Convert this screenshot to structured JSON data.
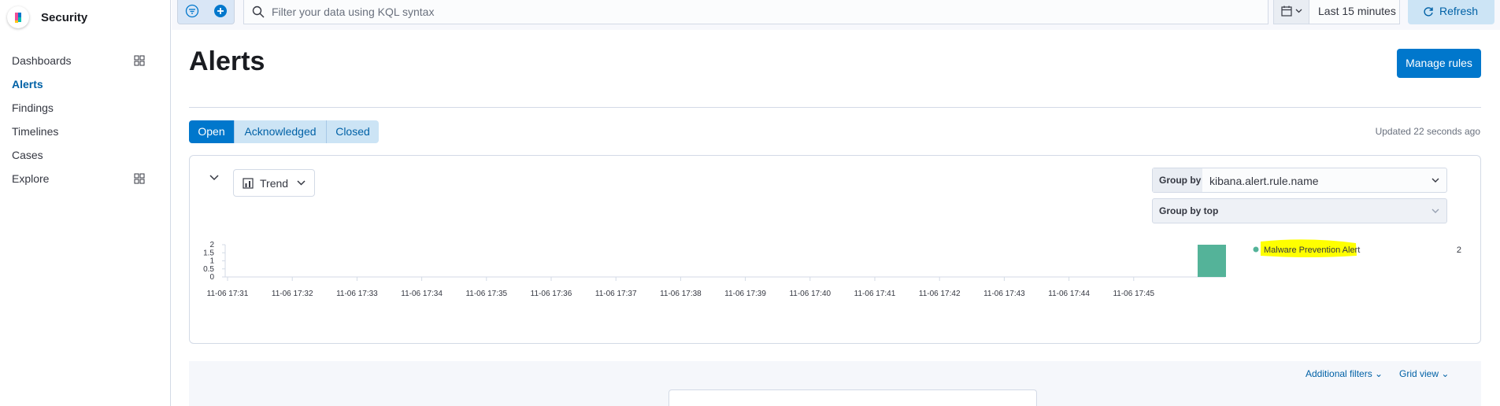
{
  "app": {
    "title": "Security"
  },
  "sidebar": {
    "items": [
      {
        "label": "Dashboards",
        "icon": "grid-icon"
      },
      {
        "label": "Alerts",
        "active": true
      },
      {
        "label": "Findings"
      },
      {
        "label": "Timelines"
      },
      {
        "label": "Cases"
      },
      {
        "label": "Explore",
        "icon": "grid-icon"
      }
    ]
  },
  "topbar": {
    "search_placeholder": "Filter your data using KQL syntax",
    "date_range": "Last 15 minutes",
    "refresh_label": "Refresh"
  },
  "page": {
    "title": "Alerts",
    "manage_rules_label": "Manage rules",
    "tabs": [
      "Open",
      "Acknowledged",
      "Closed"
    ],
    "selected_tab": "Open",
    "updated_text": "Updated 22 seconds ago"
  },
  "trend_panel": {
    "view_label": "Trend",
    "group_by_label": "Group by",
    "group_by_value": "kibana.alert.rule.name",
    "group_by_top_label": "Group by top"
  },
  "chart_data": {
    "type": "bar",
    "x": [
      "11-06 17:31",
      "11-06 17:32",
      "11-06 17:33",
      "11-06 17:34",
      "11-06 17:35",
      "11-06 17:36",
      "11-06 17:37",
      "11-06 17:38",
      "11-06 17:39",
      "11-06 17:40",
      "11-06 17:41",
      "11-06 17:42",
      "11-06 17:43",
      "11-06 17:44",
      "11-06 17:45"
    ],
    "y_ticks": [
      "0",
      "0.5",
      "1",
      "1.5",
      "2"
    ],
    "ylim": [
      0,
      2
    ],
    "series": [
      {
        "name": "Malware Prevention Alert",
        "color": "#54b399",
        "points": [
          {
            "x": "17:46",
            "value": 2
          }
        ]
      }
    ],
    "legend": [
      {
        "label": "Malware Prevention Alert",
        "value": "2",
        "color": "#54b399",
        "highlight": "#ffff00"
      }
    ],
    "legend_position": "right"
  },
  "bottom": {
    "additional_filters_label": "Additional filters",
    "grid_view_label": "Grid view"
  }
}
